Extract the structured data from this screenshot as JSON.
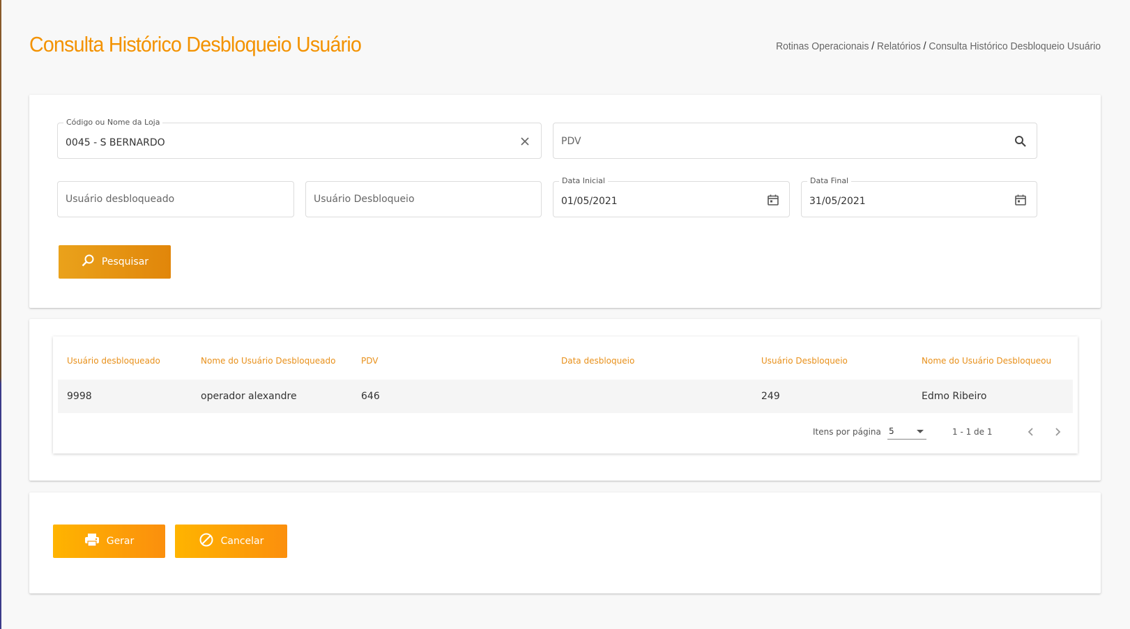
{
  "page": {
    "title": "Consulta Histórico Desbloqueio Usuário",
    "breadcrumb": [
      "Rotinas Operacionais",
      "Relatórios",
      "Consulta Histórico Desbloqueio Usuário"
    ],
    "breadcrumb_separator": "/"
  },
  "filters": {
    "store": {
      "label": "Código ou Nome da Loja",
      "value": "0045 - S BERNARDO",
      "clear_icon": "close-icon"
    },
    "pdv": {
      "placeholder": "PDV",
      "icon": "search-icon"
    },
    "unlocked_user": {
      "placeholder": "Usuário desbloqueado"
    },
    "unlock_user": {
      "placeholder": "Usuário Desbloqueio"
    },
    "start_date": {
      "label": "Data Inicial",
      "value": "01/05/2021",
      "icon": "calendar-icon"
    },
    "end_date": {
      "label": "Data Final",
      "value": "31/05/2021",
      "icon": "calendar-icon"
    },
    "search_button": {
      "label": "Pesquisar",
      "icon": "search-icon"
    }
  },
  "table": {
    "columns": [
      "Usuário desbloqueado",
      "Nome do Usuário Desbloqueado",
      "PDV",
      "Data desbloqueio",
      "Usuário Desbloqueio",
      "Nome do Usuário Desbloqueou"
    ],
    "rows": [
      [
        "9998",
        "operador alexandre",
        "646",
        "",
        "249",
        "Edmo Ribeiro"
      ]
    ],
    "paginator": {
      "items_per_page_label": "Itens por página",
      "page_size": "5",
      "range": "1 - 1 de 1"
    }
  },
  "actions": {
    "generate": {
      "label": "Gerar",
      "icon": "printer-icon"
    },
    "cancel": {
      "label": "Cancelar",
      "icon": "cancel-icon"
    }
  },
  "colors": {
    "accent": "#f39200",
    "header_text": "#e8901a",
    "button_gradient_start": "#ffb400",
    "button_gradient_end": "#fb8f0d"
  }
}
